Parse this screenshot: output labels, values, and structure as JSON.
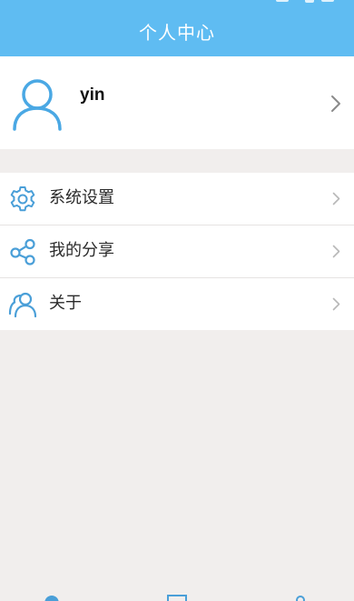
{
  "header": {
    "title": "个人中心"
  },
  "profile": {
    "username": "yin",
    "avatar_icon": "user-avatar-icon",
    "chevron_icon": "chevron-right-icon"
  },
  "menu": {
    "items": [
      {
        "label": "系统设置",
        "icon": "gear-icon"
      },
      {
        "label": "我的分享",
        "icon": "share-icon"
      },
      {
        "label": "关于",
        "icon": "people-icon"
      }
    ]
  },
  "tabbar": {
    "icons": [
      "home-icon",
      "book-icon",
      "profile-icon"
    ]
  },
  "colors": {
    "accent": "#5fbcf2",
    "background": "#f1eeed",
    "surface": "#ffffff",
    "icon": "#4a9fd8"
  }
}
